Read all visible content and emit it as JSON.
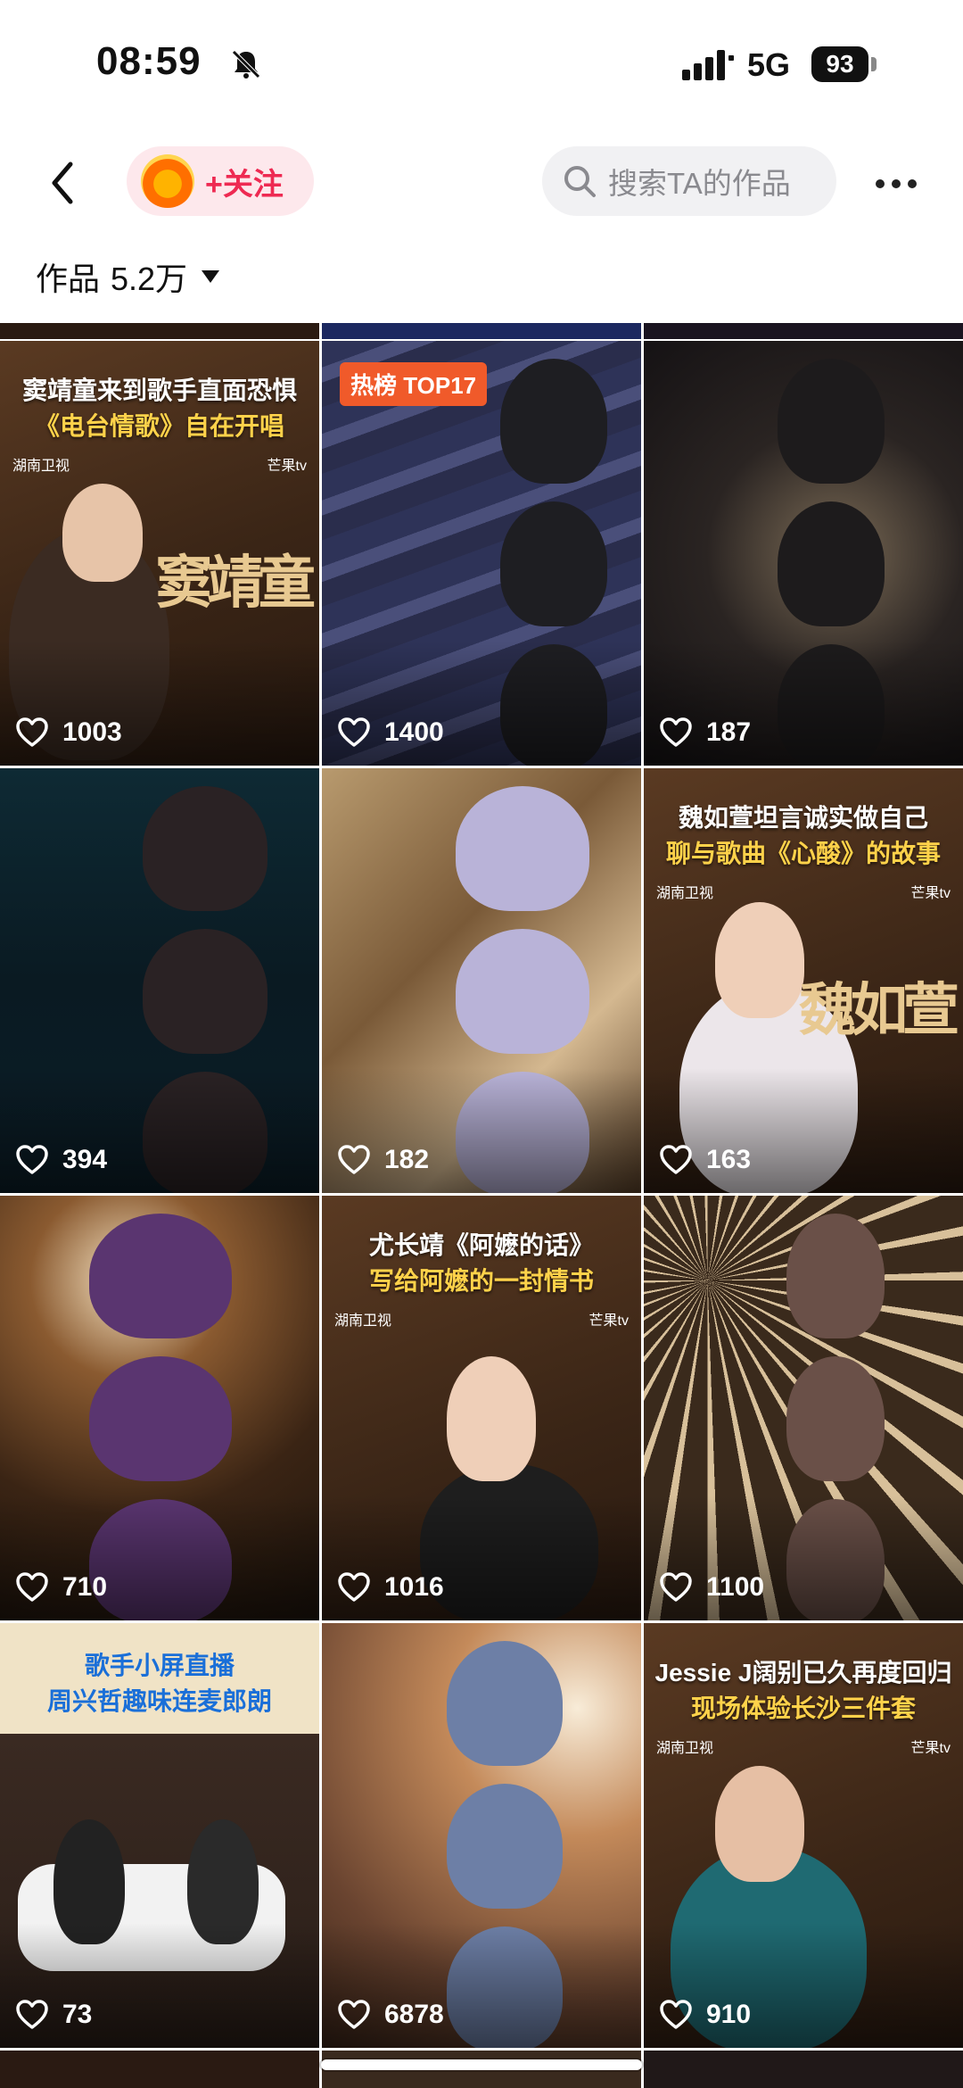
{
  "status_bar": {
    "time": "08:59",
    "network": "5G",
    "battery": "93"
  },
  "nav": {
    "follow_label": "+关注",
    "search_placeholder": "搜索TA的作品"
  },
  "works": {
    "label": "作品",
    "count": "5.2万"
  },
  "tiles": [
    {
      "likes": "1003",
      "caption1": "窦靖童来到歌手直面恐惧",
      "caption2": "《电台情歌》自在开唱",
      "name_art": "窦靖童",
      "logo_left": "湖南卫视",
      "logo_right": "芒果tv"
    },
    {
      "likes": "1400",
      "badge": "热榜 TOP17"
    },
    {
      "likes": "187"
    },
    {
      "likes": "394"
    },
    {
      "likes": "182"
    },
    {
      "likes": "163",
      "caption1": "魏如萱坦言诚实做自己",
      "caption2": "聊与歌曲《心酸》的故事",
      "name_art": "魏如萱",
      "logo_left": "湖南卫视",
      "logo_right": "芒果tv"
    },
    {
      "likes": "710"
    },
    {
      "likes": "1016",
      "caption1": "尤长靖《阿嬷的话》",
      "caption2": "写给阿嬷的一封情书",
      "logo_left": "湖南卫视",
      "logo_right": "芒果tv"
    },
    {
      "likes": "1100"
    },
    {
      "likes": "73",
      "caption1": "歌手小屏直播",
      "caption2": "周兴哲趣味连麦郎朗"
    },
    {
      "likes": "6878"
    },
    {
      "likes": "910",
      "caption1": "Jessie J阔别已久再度回归",
      "caption2": "现场体验长沙三件套",
      "logo_left": "湖南卫视",
      "logo_right": "芒果tv"
    }
  ],
  "colors": {
    "follow_text": "#ee2a52",
    "follow_bg": "#fde8ec",
    "search_bg": "#f1f1f3",
    "caption_yellow": "#ffd24a",
    "hot_badge": "#f05a2a"
  }
}
